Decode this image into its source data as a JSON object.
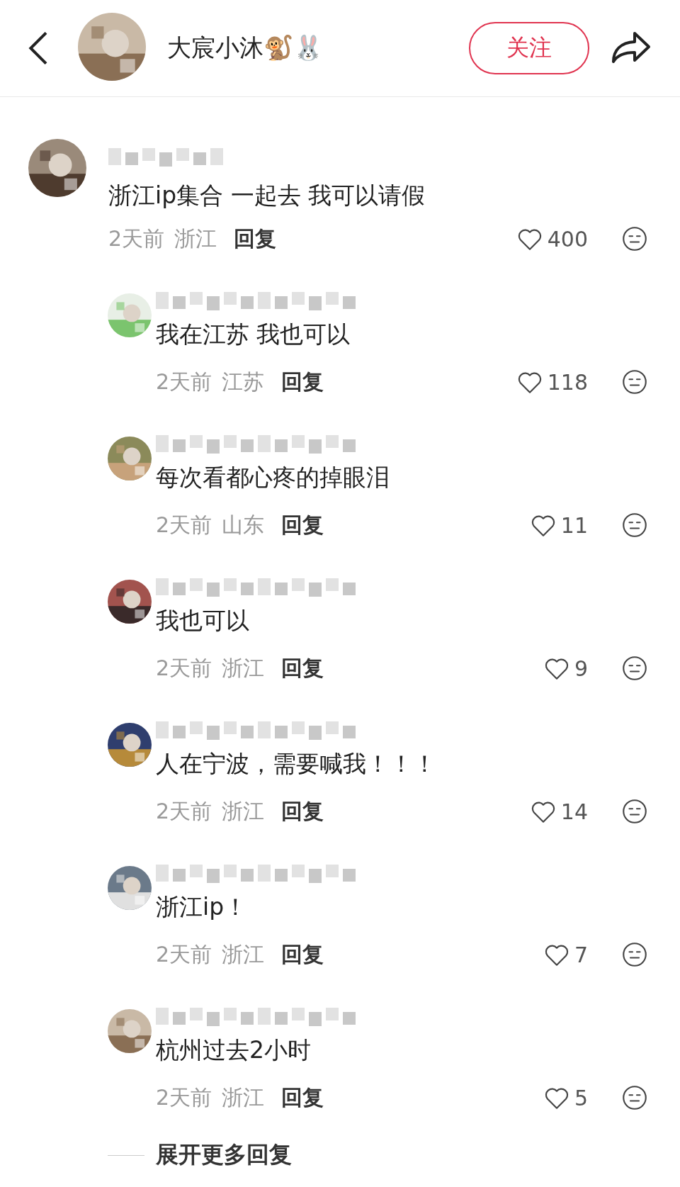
{
  "header": {
    "name": "大宸小沐🐒🐰",
    "follow_button": "关注"
  },
  "comment": {
    "text": "浙江ip集合 一起去 我可以请假",
    "time": "2天前",
    "location": "浙江",
    "reply_button": "回复",
    "likes": "400"
  },
  "replies": [
    {
      "text": "我在江苏 我也可以",
      "time": "2天前",
      "location": "江苏",
      "reply_button": "回复",
      "likes": "118"
    },
    {
      "text": "每次看都心疼的掉眼泪",
      "time": "2天前",
      "location": "山东",
      "reply_button": "回复",
      "likes": "11"
    },
    {
      "text": "我也可以",
      "time": "2天前",
      "location": "浙江",
      "reply_button": "回复",
      "likes": "9"
    },
    {
      "text": "人在宁波，需要喊我！！！",
      "time": "2天前",
      "location": "浙江",
      "reply_button": "回复",
      "likes": "14"
    },
    {
      "text": "浙江ip！",
      "time": "2天前",
      "location": "浙江",
      "reply_button": "回复",
      "likes": "7"
    },
    {
      "text": "杭州过去2小时",
      "time": "2天前",
      "location": "浙江",
      "reply_button": "回复",
      "likes": "5"
    }
  ],
  "expand_link": "展开更多回复"
}
